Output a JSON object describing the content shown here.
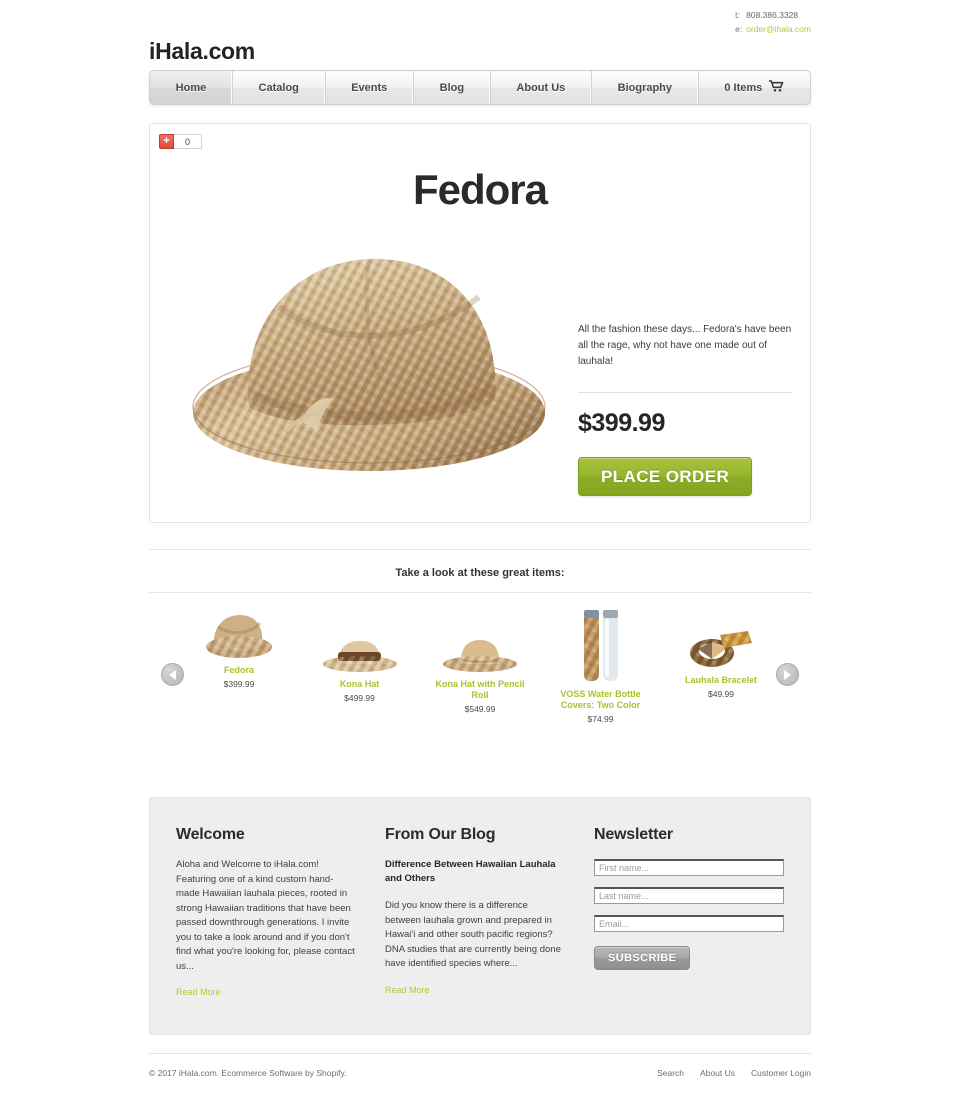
{
  "header": {
    "logo": "iHala.com",
    "contact": {
      "phone_label": "t:",
      "phone": "808.386.3328",
      "email_label": "e:",
      "email": "order@ihala.com"
    }
  },
  "nav": {
    "items": [
      {
        "label": "Home",
        "active": true
      },
      {
        "label": "Catalog",
        "active": false
      },
      {
        "label": "Events",
        "active": false
      },
      {
        "label": "Blog",
        "active": false
      },
      {
        "label": "About Us",
        "active": false
      },
      {
        "label": "Biography",
        "active": false
      }
    ],
    "cart_label": "0 Items",
    "cart_icon": "shopping-cart-icon"
  },
  "social": {
    "plus_one_label": "+",
    "plus_one_count": "0"
  },
  "product": {
    "title": "Fedora",
    "image_alt": "woven-straw-fedora-hat",
    "description": "All the fashion these days... Fedora's have been all the rage, why not have one made out of lauhala!",
    "price": "$399.99",
    "order_button": "PLACE ORDER"
  },
  "related": {
    "heading": "Take a look at these great items:",
    "prev_icon": "chevron-left-icon",
    "next_icon": "chevron-right-icon",
    "items": [
      {
        "name": "Fedora",
        "price": "$399.99",
        "image_alt": "fedora-hat"
      },
      {
        "name": "Kona Hat",
        "price": "$499.99",
        "image_alt": "kona-hat"
      },
      {
        "name": "Kona Hat with Pencil Roll",
        "price": "$549.99",
        "image_alt": "kona-hat-pencil-roll"
      },
      {
        "name": "VOSS Water Bottle Covers: Two Color",
        "price": "$74.99",
        "image_alt": "voss-water-bottle-covers"
      },
      {
        "name": "Lauhala Bracelet",
        "price": "$49.99",
        "image_alt": "lauhala-bracelet"
      }
    ]
  },
  "welcome": {
    "heading": "Welcome",
    "body": "Aloha and Welcome to iHala.com! Featuring one of a kind custom hand-made Hawaiian lauhala pieces, rooted in strong Hawaiian traditions that have been passed downthrough generations.  I invite you to take a look around and if you don't find what you're looking for, please contact us...",
    "read_more": "Read More"
  },
  "blog": {
    "heading": "From Our Blog",
    "post_title": "Difference Between Hawaiian Lauhala and Others",
    "excerpt": "Did you know there is a difference between lauhala grown and prepared in Hawai'i and other south pacific regions?  DNA studies that are currently being done have identified species where...",
    "read_more": "Read More"
  },
  "newsletter": {
    "heading": "Newsletter",
    "first_name_placeholder": "First name...",
    "last_name_placeholder": "Last name...",
    "email_placeholder": "Email...",
    "first_name_value": "",
    "last_name_value": "",
    "email_value": "",
    "subscribe_label": "SUBSCRIBE"
  },
  "footer": {
    "copyright": "© 2017 iHala.com. Ecommerce Software by Shopify.",
    "links": [
      "Search",
      "About Us",
      "Customer Login"
    ]
  },
  "colors": {
    "accent_green": "#aac32a",
    "link_green": "#b5c73a",
    "button_green": "#95b52e",
    "plus_one_red": "#dd4b39",
    "panel_gray": "#eeeeee"
  }
}
